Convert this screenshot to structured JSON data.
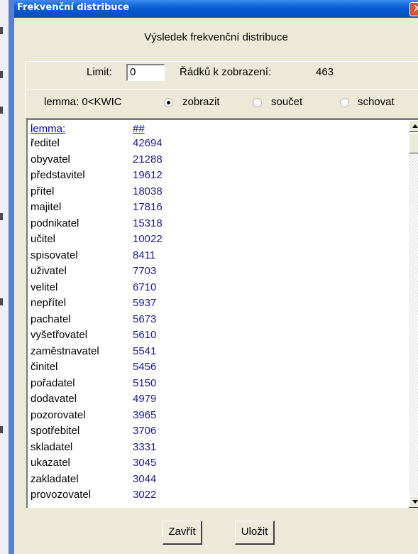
{
  "window": {
    "title": "Frekvenční distribuce",
    "heading": "Výsledek frekvenční distribuce"
  },
  "controls": {
    "limit_label": "Limit:",
    "limit_value": "0",
    "rows_label": "Řádků k zobrazení:",
    "rows_count": "463",
    "lemma_label": "lemma: 0<KWIC",
    "options": [
      {
        "label": "zobrazit",
        "selected": true
      },
      {
        "label": "součet",
        "selected": false
      },
      {
        "label": "schovat",
        "selected": false
      }
    ]
  },
  "list": {
    "header": {
      "word": "lemma:",
      "count": "##"
    },
    "rows": [
      {
        "word": "ředitel",
        "count": "42694"
      },
      {
        "word": "obyvatel",
        "count": "21288"
      },
      {
        "word": "představitel",
        "count": "19612"
      },
      {
        "word": "přítel",
        "count": "18038"
      },
      {
        "word": "majitel",
        "count": "17816"
      },
      {
        "word": "podnikatel",
        "count": "15318"
      },
      {
        "word": "učitel",
        "count": "10022"
      },
      {
        "word": "spisovatel",
        "count": "8411"
      },
      {
        "word": "uživatel",
        "count": "7703"
      },
      {
        "word": "velitel",
        "count": "6710"
      },
      {
        "word": "nepřítel",
        "count": "5937"
      },
      {
        "word": "pachatel",
        "count": "5673"
      },
      {
        "word": "vyšetřovatel",
        "count": "5610"
      },
      {
        "word": "zaměstnavatel",
        "count": "5541"
      },
      {
        "word": "činitel",
        "count": "5456"
      },
      {
        "word": "pořadatel",
        "count": "5150"
      },
      {
        "word": "dodavatel",
        "count": "4979"
      },
      {
        "word": "pozorovatel",
        "count": "3965"
      },
      {
        "word": "spotřebitel",
        "count": "3706"
      },
      {
        "word": "skladatel",
        "count": "3331"
      },
      {
        "word": "ukazatel",
        "count": "3045"
      },
      {
        "word": "zakladatel",
        "count": "3044"
      },
      {
        "word": "provozovatel",
        "count": "3022"
      }
    ]
  },
  "buttons": {
    "close": "Zavřít",
    "save": "Uložit",
    "title_close_glyph": "X"
  },
  "colors": {
    "titlebar": "#0a5fd8",
    "window_bg": "#ece9d8",
    "count_text": "#1a1a9a",
    "link": "#0000cc"
  }
}
